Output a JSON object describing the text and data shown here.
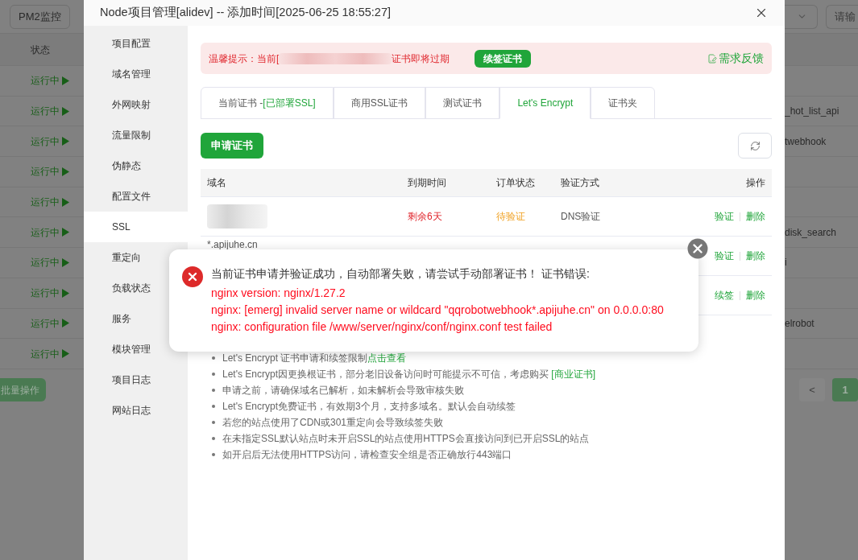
{
  "background": {
    "top_button": "PM2监控",
    "search_placeholder": "请输",
    "status_header": "状态",
    "rows": [
      {
        "status": "运行中",
        "name": ""
      },
      {
        "status": "运行中",
        "name": "_hot_list_api"
      },
      {
        "status": "运行中",
        "name": "twebhook"
      },
      {
        "status": "运行中",
        "name": ""
      },
      {
        "status": "运行中",
        "name": ""
      },
      {
        "status": "运行中",
        "name": "disk_search"
      },
      {
        "status": "运行中",
        "name": "i"
      },
      {
        "status": "运行中",
        "name": ""
      },
      {
        "status": "运行中",
        "name": "elrobot"
      },
      {
        "status": "运行中",
        "name": ""
      }
    ],
    "batch_button": "批量操作",
    "pagination": {
      "prev": "<",
      "pages": [
        {
          "label": "1",
          "selected": true
        }
      ]
    }
  },
  "window": {
    "title": "Node项目管理[alidev] -- 添加时间[2025-06-25 18:55:27]"
  },
  "sidebar": {
    "items": [
      {
        "label": "项目配置",
        "selected": false
      },
      {
        "label": "域名管理",
        "selected": false
      },
      {
        "label": "外网映射",
        "selected": false
      },
      {
        "label": "流量限制",
        "selected": false
      },
      {
        "label": "伪静态",
        "selected": false
      },
      {
        "label": "配置文件",
        "selected": false
      },
      {
        "label": "SSL",
        "selected": true
      },
      {
        "label": "重定向",
        "selected": false
      },
      {
        "label": "负载状态",
        "selected": false
      },
      {
        "label": "服务",
        "selected": false
      },
      {
        "label": "模块管理",
        "selected": false
      },
      {
        "label": "项目日志",
        "selected": false
      },
      {
        "label": "网站日志",
        "selected": false
      }
    ]
  },
  "alert": {
    "prefix": "温馨提示：当前[",
    "suffix": "证书即将过期",
    "button": "续签证书",
    "feedback": "需求反馈"
  },
  "tabs": [
    {
      "label": "当前证书 -**[已部署SSL]**",
      "selected": false
    },
    {
      "label": "商用SSL证书",
      "selected": false
    },
    {
      "label": "测试证书",
      "selected": false
    },
    {
      "label": "Let's Encrypt",
      "selected": true
    },
    {
      "label": "证书夹",
      "selected": false
    }
  ],
  "apply_button": "申请证书",
  "table": {
    "columns": [
      "域名",
      "到期时间",
      "订单状态",
      "验证方式",
      "操作"
    ],
    "rows": [
      {
        "domain": "",
        "expiry": "剩余6天",
        "status": "待验证",
        "method": "DNS验证",
        "actions": [
          "验证",
          "删除"
        ]
      },
      {
        "domain": "*.apijuhe.cn",
        "expiry": "",
        "status": "",
        "method": "",
        "actions": [
          "验证",
          "删除"
        ]
      },
      {
        "domain": "",
        "expiry": "",
        "status": "",
        "method": "",
        "actions": [
          "续签",
          "删除"
        ]
      }
    ]
  },
  "notes": [
    {
      "text": "Let's Encrypt 证书申请和续签限制",
      "link": "点击查看"
    },
    {
      "text": "Let's Encrypt因更换根证书，部分老旧设备访问时可能提示不可信，考虑购买 ",
      "link": "[商业证书]"
    },
    {
      "text": "申请之前，请确保域名已解析，如未解析会导致审核失败"
    },
    {
      "text": "Let's Encrypt免费证书，有效期3个月，支持多域名。默认会自动续签"
    },
    {
      "text": "若您的站点使用了CDN或301重定向会导致续签失败"
    },
    {
      "text": "在未指定SSL默认站点时未开启SSL的站点使用HTTPS会直接访问到已开启SSL的站点"
    },
    {
      "text": "如开启后无法使用HTTPS访问，请检查安全组是否正确放行443端口"
    }
  ],
  "error_popup": {
    "message": "当前证书申请并验证成功，自动部署失败，请尝试手动部署证书！ 证书错误:",
    "details": [
      "nginx version: nginx/1.27.2",
      "nginx: [emerg] invalid server name or wildcard \"qqrobotwebhook*.apijuhe.cn\" on 0.0.0.0:80",
      "nginx: configuration file /www/server/nginx/conf/nginx.conf test failed"
    ]
  }
}
